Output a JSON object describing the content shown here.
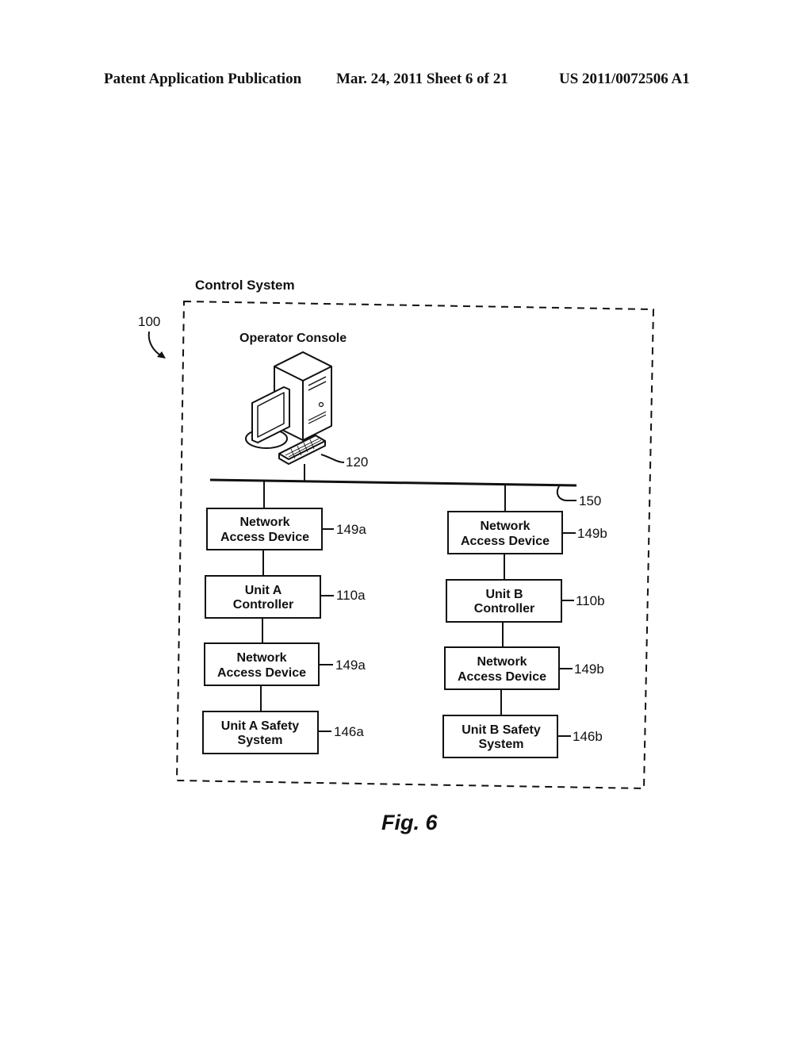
{
  "header": {
    "left": "Patent Application Publication",
    "middle": "Mar. 24, 2011  Sheet 6 of 21",
    "right": "US 2011/0072506 A1"
  },
  "diagram": {
    "system_label": "Control System",
    "system_ref": "100",
    "console": {
      "label": "Operator Console",
      "ref": "120"
    },
    "bus_ref": "150",
    "columns": [
      {
        "name": "A",
        "blocks": [
          {
            "line1": "Network",
            "line2": "Access Device",
            "ref": "149a"
          },
          {
            "line1": "Unit A",
            "line2": "Controller",
            "ref": "110a"
          },
          {
            "line1": "Network",
            "line2": "Access Device",
            "ref": "149a"
          },
          {
            "line1": "Unit A Safety",
            "line2": "System",
            "ref": "146a"
          }
        ]
      },
      {
        "name": "B",
        "blocks": [
          {
            "line1": "Network",
            "line2": "Access Device",
            "ref": "149b"
          },
          {
            "line1": "Unit B",
            "line2": "Controller",
            "ref": "110b"
          },
          {
            "line1": "Network",
            "line2": "Access Device",
            "ref": "149b"
          },
          {
            "line1": "Unit B Safety",
            "line2": "System",
            "ref": "146b"
          }
        ]
      }
    ]
  },
  "figure_caption": "Fig. 6"
}
